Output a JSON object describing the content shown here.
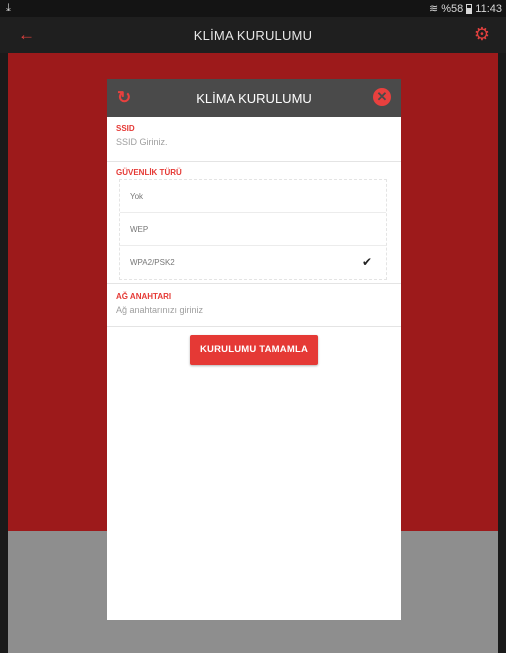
{
  "status_bar": {
    "left_icon": "download-icon",
    "battery_text": "%58",
    "time": "11:43"
  },
  "app_bar": {
    "title": "KLİMA KURULUMU",
    "back_icon": "back-arrow-icon",
    "settings_icon": "gear-icon"
  },
  "modal": {
    "title": "KLİMA KURULUMU",
    "refresh_icon": "refresh-icon",
    "close_icon": "close-icon",
    "ssid": {
      "label": "SSID",
      "placeholder": "SSID Giriniz."
    },
    "security": {
      "label": "GÜVENLİK TÜRÜ",
      "options": [
        "Yok",
        "WEP",
        "WPA2/PSK2"
      ],
      "selected": "WPA2/PSK2"
    },
    "network_key": {
      "label": "AĞ ANAHTARI",
      "placeholder": "Ağ anahtarınızı giriniz"
    },
    "submit_label": "KURULUMU TAMAMLA"
  },
  "colors": {
    "accent_red": "#e53935",
    "background_red": "#9d1a1b",
    "header_dark": "#4a4a4a"
  }
}
